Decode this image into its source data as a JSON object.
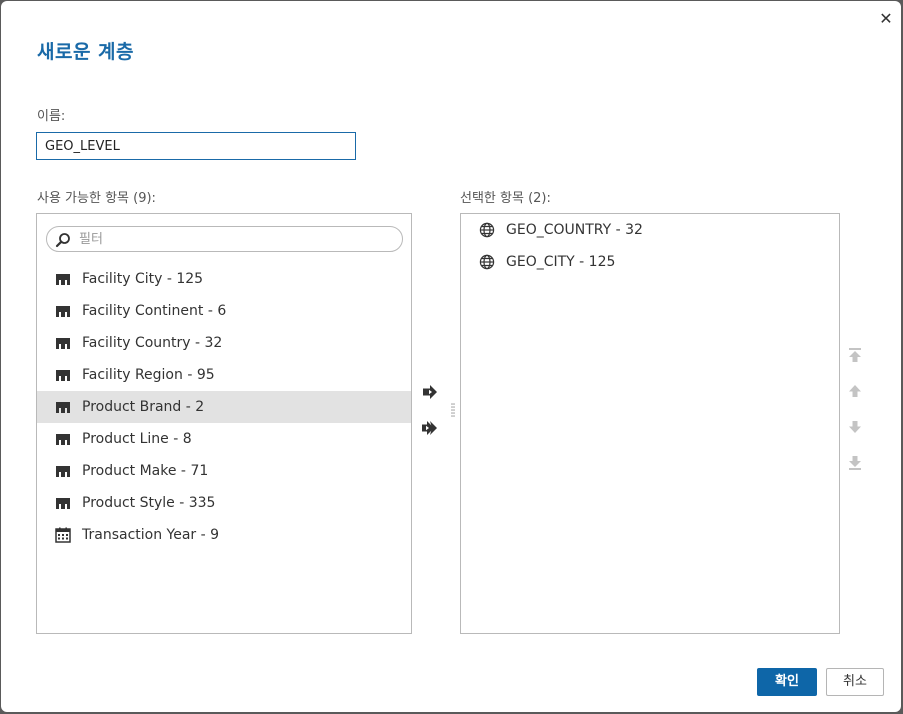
{
  "dialog": {
    "title": "새로운 계층",
    "close_icon": "close-icon",
    "name_label": "이름:",
    "name_value": "GEO_LEVEL",
    "available_label": "사용 가능한 항목 (9):",
    "selected_label": "선택한 항목 (2):",
    "filter_placeholder": "필터",
    "ok_label": "확인",
    "cancel_label": "취소"
  },
  "available_items": [
    {
      "label": "Facility City - 125",
      "icon": "dimension-icon",
      "selected": false
    },
    {
      "label": "Facility Continent - 6",
      "icon": "dimension-icon",
      "selected": false
    },
    {
      "label": "Facility Country - 32",
      "icon": "dimension-icon",
      "selected": false
    },
    {
      "label": "Facility Region - 95",
      "icon": "dimension-icon",
      "selected": false
    },
    {
      "label": "Product Brand - 2",
      "icon": "dimension-icon",
      "selected": true
    },
    {
      "label": "Product Line - 8",
      "icon": "dimension-icon",
      "selected": false
    },
    {
      "label": "Product Make - 71",
      "icon": "dimension-icon",
      "selected": false
    },
    {
      "label": "Product Style - 335",
      "icon": "dimension-icon",
      "selected": false
    },
    {
      "label": "Transaction Year - 9",
      "icon": "calendar-icon",
      "selected": false
    }
  ],
  "selected_items": [
    {
      "label": "GEO_COUNTRY - 32",
      "icon": "globe-icon"
    },
    {
      "label": "GEO_CITY - 125",
      "icon": "globe-icon"
    }
  ],
  "colors": {
    "accent": "#1a6aa8",
    "primary_button": "#0e66a8",
    "selected_row": "#e2e2e2",
    "disabled_icon": "#c4c4c4"
  }
}
